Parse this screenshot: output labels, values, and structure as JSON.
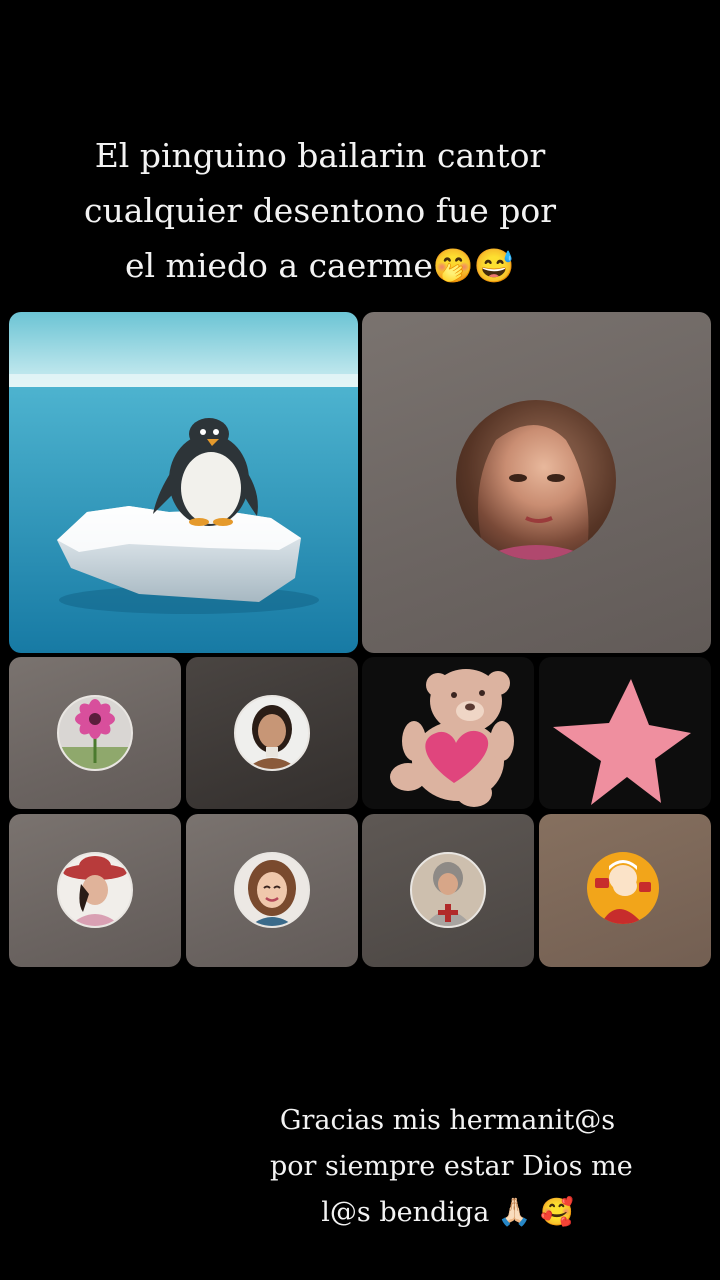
{
  "caption_top": {
    "line1": "El pinguino bailarin cantor",
    "line2": "cualquier desentono fue por",
    "line3": "el miedo a caerme🤭😅"
  },
  "tiles": [
    {
      "id": "penguin",
      "icon": "penguin-on-iceberg"
    },
    {
      "id": "host",
      "icon": "woman-avatar"
    },
    {
      "id": "flower",
      "icon": "flower-avatar"
    },
    {
      "id": "woman-brown",
      "icon": "woman-avatar"
    },
    {
      "id": "teddy",
      "icon": "teddy-bear-heart"
    },
    {
      "id": "star",
      "icon": "pink-star"
    },
    {
      "id": "woman-hat",
      "icon": "woman-hat-avatar"
    },
    {
      "id": "cartoon-woman",
      "icon": "cartoon-woman-avatar"
    },
    {
      "id": "knight",
      "icon": "knight-avatar"
    },
    {
      "id": "popeye",
      "icon": "popeye-avatar"
    }
  ],
  "colors": {
    "background": "#000000",
    "tile_gray": "#6b6461",
    "text": "#f3f3f3"
  },
  "caption_bottom": {
    "line1": "Gracias mis hermanit@s",
    "line2": "por siempre estar Dios me",
    "line3": "l@s bendiga 🙏🏻 🥰"
  }
}
